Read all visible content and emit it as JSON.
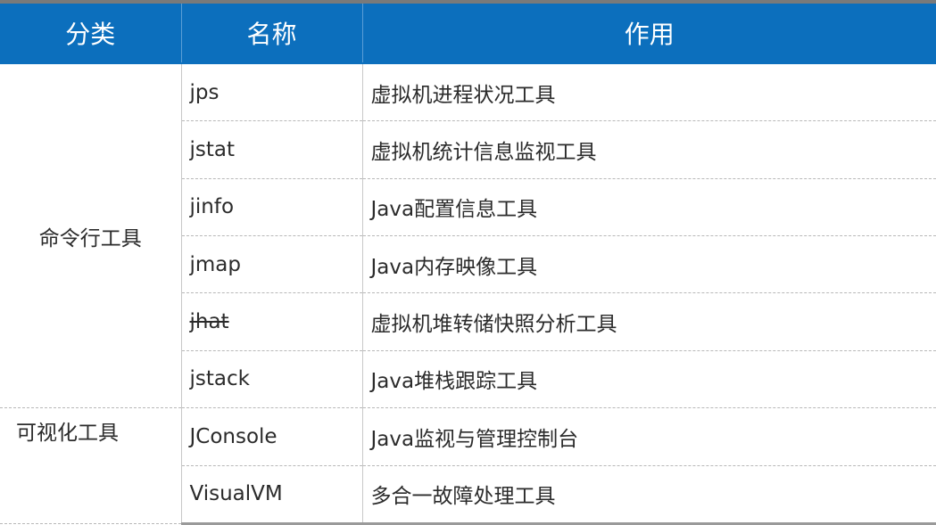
{
  "headers": [
    "分类",
    "名称",
    "作用"
  ],
  "categories": {
    "command_line": "命令行工具",
    "visual": "可视化工具"
  },
  "rows": [
    {
      "name": "jps",
      "purpose": "虚拟机进程状况工具"
    },
    {
      "name": "jstat",
      "purpose": "虚拟机统计信息监视工具"
    },
    {
      "name": "jinfo",
      "purpose": "Java配置信息工具"
    },
    {
      "name": "jmap",
      "purpose": "Java内存映像工具"
    },
    {
      "name": "jhat",
      "purpose": "虚拟机堆转储快照分析工具",
      "strikethrough": true
    },
    {
      "name": "jstack",
      "purpose": "Java堆栈跟踪工具"
    },
    {
      "name": "JConsole",
      "purpose": "Java监视与管理控制台"
    },
    {
      "name": "VisualVM",
      "purpose": "多合一故障处理工具"
    }
  ],
  "colors": {
    "header_bg": "#0c6fbd",
    "header_text": "#ffffff",
    "body_text": "#2b2b2b"
  }
}
